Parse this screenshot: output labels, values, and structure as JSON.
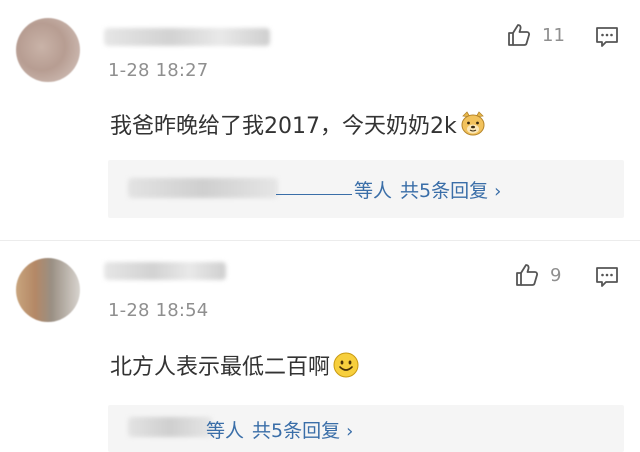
{
  "comments": [
    {
      "time": "1-28 18:27",
      "text": "我爸昨晚给了我2017，今天奶奶2k",
      "emoji": "doge-face",
      "likes": "11",
      "replies": {
        "users_suffix": "等人",
        "total": "共5条回复"
      }
    },
    {
      "time": "1-28 18:54",
      "text": "北方人表示最低二百啊",
      "emoji": "smile-face",
      "likes": "9",
      "replies": {
        "users_suffix": "等人",
        "total": "共5条回复"
      }
    }
  ],
  "colors": {
    "link": "#3a6ea8",
    "meta": "#8f8f8f",
    "body_text": "#333333",
    "reply_bg": "#f5f5f5"
  },
  "icons": {
    "like": "thumbs-up-icon",
    "comment": "comment-bubble-icon",
    "chevron": "chevron-right-icon"
  },
  "reply_chevron": "›"
}
